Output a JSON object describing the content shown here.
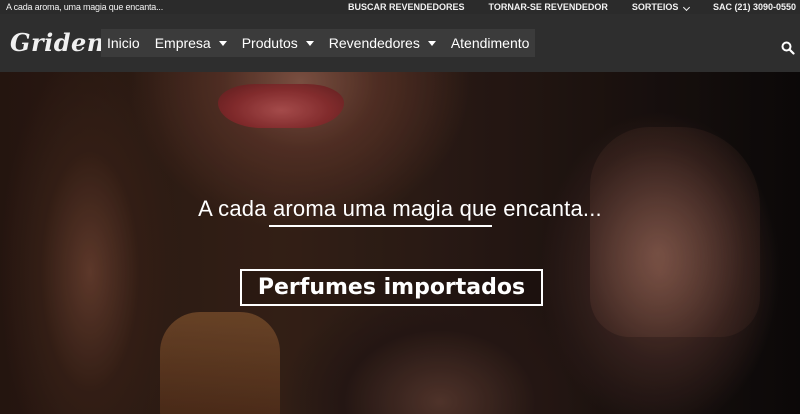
{
  "topbar": {
    "tagline": "A cada aroma, uma magia que encanta...",
    "links": {
      "find_resellers": "BUSCAR REVENDEDORES",
      "become_reseller": "TORNAR-SE REVENDEDOR",
      "giveaways": "SORTEIOS",
      "sac": "SAC (21) 3090-0550"
    }
  },
  "navbar": {
    "logo": "Griden",
    "items": [
      {
        "label": "Inicio",
        "dropdown": false
      },
      {
        "label": "Empresa",
        "dropdown": true
      },
      {
        "label": "Produtos",
        "dropdown": true
      },
      {
        "label": "Revendedores",
        "dropdown": true
      },
      {
        "label": "Atendimento",
        "dropdown": false
      }
    ],
    "search_icon": "search-icon"
  },
  "hero": {
    "headline": "A cada aroma uma magia que encanta...",
    "cta_label": "Perfumes importados"
  },
  "colors": {
    "topbar_bg": "#2b2b2b",
    "navbar_bg": "#2e2e2e",
    "menu_bg": "#3b3b3b",
    "text": "#ffffff"
  }
}
